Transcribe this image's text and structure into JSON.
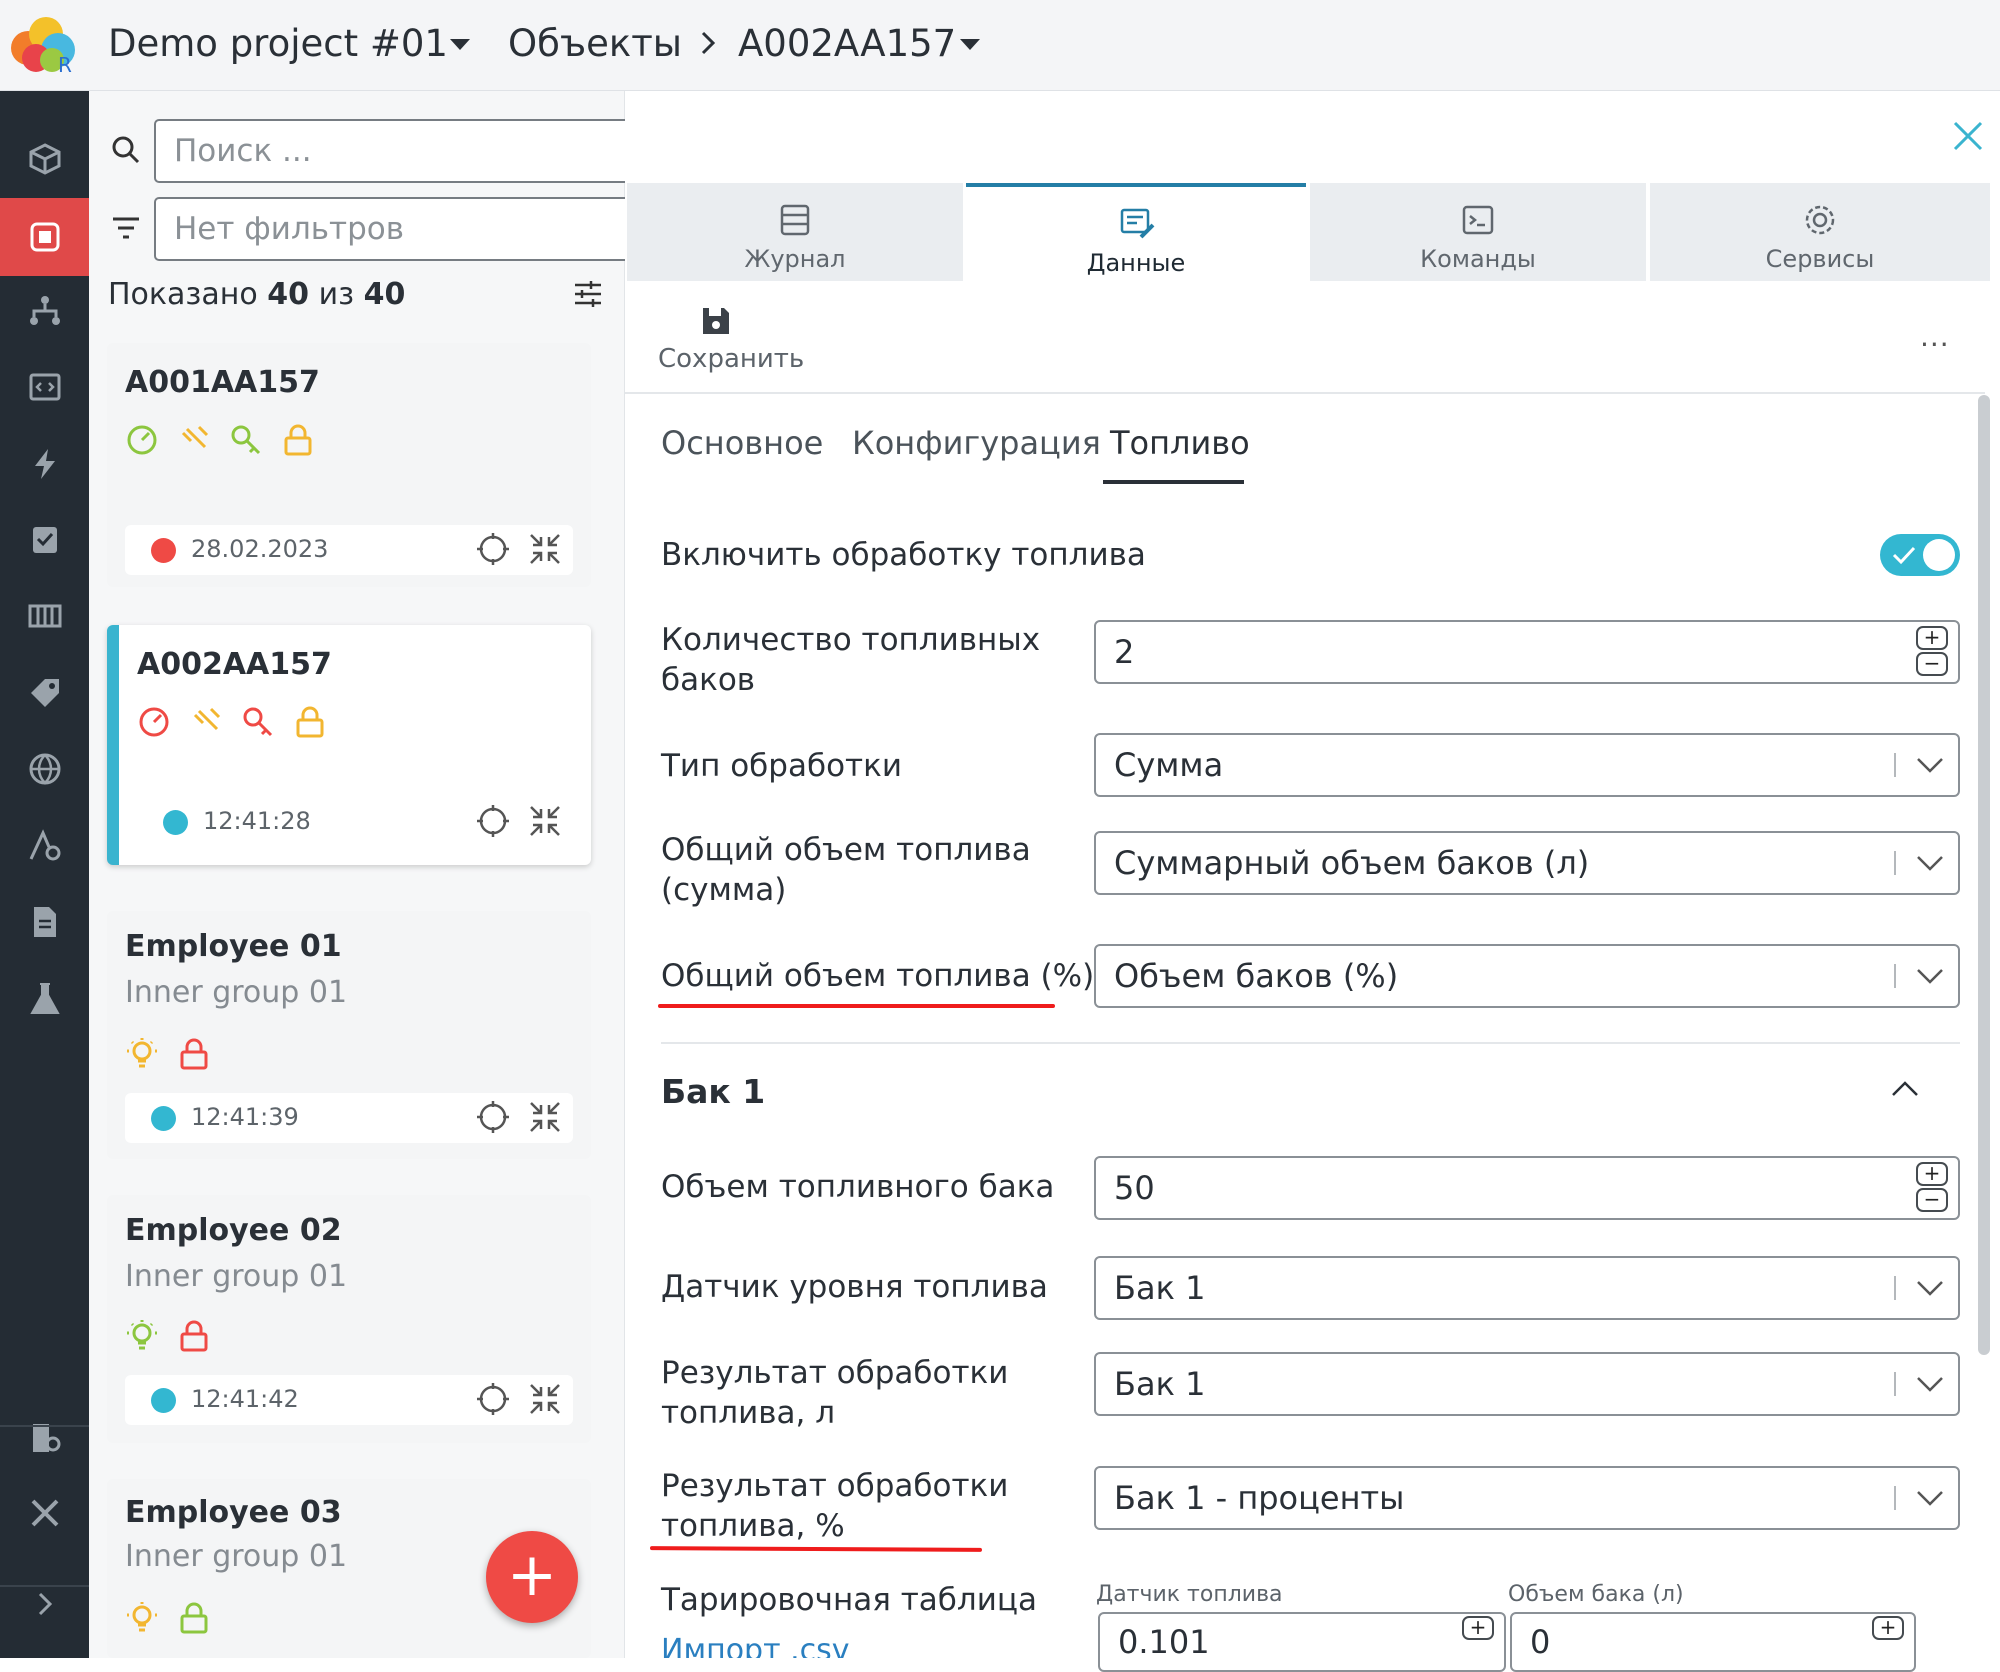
{
  "header": {
    "project": "Demo project #01",
    "section": "Объекты",
    "object": "A002AA157"
  },
  "rail": {
    "icons": [
      "cube-icon",
      "objects-icon",
      "hierarchy-icon",
      "code-window-icon",
      "lightning-icon",
      "clipboard-check-icon",
      "columns-icon",
      "tag-icon",
      "globe-icon",
      "geo-settings-icon",
      "document-icon",
      "flask-icon",
      "admin-icon",
      "tools-icon",
      "expand-chevron-icon"
    ]
  },
  "list": {
    "search_placeholder": "Поиск ...",
    "filter_text": "Нет фильтров",
    "shown_prefix": "Показано",
    "shown_count": "40",
    "shown_of": "из",
    "shown_total": "40",
    "cards": [
      {
        "title": "A001AA157",
        "status_color": "#ef4a45",
        "time": "28.02.2023"
      },
      {
        "title": "A002AA157",
        "status_color": "#33b7d1",
        "time": "12:41:28"
      },
      {
        "title": "Employee 01",
        "group": "Inner group 01",
        "status_color": "#33b7d1",
        "time": "12:41:39"
      },
      {
        "title": "Employee 02",
        "group": "Inner group 01",
        "status_color": "#33b7d1",
        "time": "12:41:42"
      },
      {
        "title": "Employee 03",
        "group": "Inner group 01"
      }
    ],
    "fab_label": "+"
  },
  "tabs": [
    {
      "label": "Журнал"
    },
    {
      "label": "Данные"
    },
    {
      "label": "Команды"
    },
    {
      "label": "Сервисы"
    }
  ],
  "toolbar": {
    "save_label": "Сохранить",
    "more": "..."
  },
  "subtabs": [
    "Основное",
    "Конфигурация",
    "Топливо"
  ],
  "form": {
    "enable_label": "Включить обработку топлива",
    "enable_on": true,
    "tanks_label_1": "Количество топливных",
    "tanks_label_2": "баков",
    "tanks_value": "2",
    "proc_type_label": "Тип обработки",
    "proc_type_value": "Сумма",
    "total_sum_label_1": "Общий объем топлива",
    "total_sum_label_2": "(сумма)",
    "total_sum_value": "Суммарный объем баков (л)",
    "total_pct_label": "Общий объем топлива (%)",
    "total_pct_value": "Объем баков (%)",
    "tank_section": "Бак 1",
    "tank_volume_label": "Объем топливного бака",
    "tank_volume_value": "50",
    "level_sensor_label": "Датчик уровня топлива",
    "level_sensor_value": "Бак 1",
    "result_l_label_1": "Результат обработки",
    "result_l_label_2": "топлива, л",
    "result_l_value": "Бак 1",
    "result_pct_label_1": "Результат обработки",
    "result_pct_label_2": "топлива, %",
    "result_pct_value": "Бак 1 - проценты",
    "calib_label": "Тарировочная таблица",
    "calib_col1": "Датчик топлива",
    "calib_col2": "Объем бака (л)",
    "calib_val1": "0.101",
    "calib_val2": "0",
    "import_link": "Импорт .csv"
  },
  "colors": {
    "accent": "#247ea6",
    "toggle": "#33b7d1",
    "danger": "#ef4a45",
    "highlight": "#ef1c1c"
  }
}
